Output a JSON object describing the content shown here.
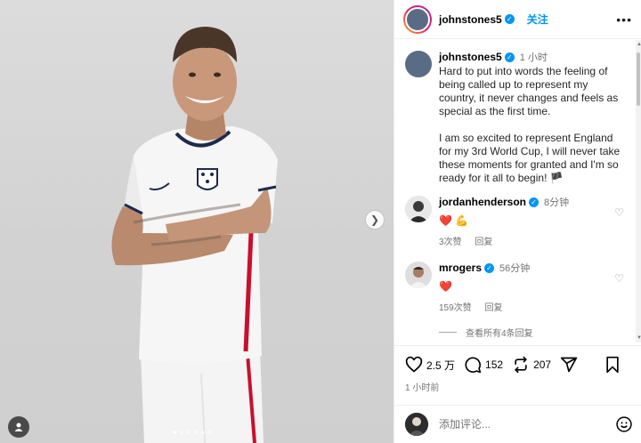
{
  "post": {
    "username": "johnstones5",
    "follow_label": "关注",
    "more_label": "•••",
    "time": "1 小时",
    "caption": "Hard to put into words the feeling of being called up to represent my country, it never changes and feels as special as the first time.\n\nI am so excited to represent England for my 3rd World Cup, I will never take these moments for granted and I'm so ready for it all to begin! 🏴",
    "posted_ago": "1 小时前"
  },
  "comments": [
    {
      "username": "jordanhenderson",
      "time": "8分钟",
      "text": "❤️ 💪",
      "likes": "3次赞",
      "reply_label": "回复"
    },
    {
      "username": "mrogers",
      "time": "56分钟",
      "text": "❤️",
      "likes": "159次赞",
      "reply_label": "回复",
      "view_all": "查看所有4条回复"
    }
  ],
  "actions": {
    "likes": "2.5 万",
    "comments": "152",
    "reposts": "207"
  },
  "composer": {
    "placeholder": "添加评论..."
  },
  "carousel": {
    "count": 6,
    "active": 0
  },
  "colors": {
    "accent": "#0095f6",
    "heart": "#ed4956",
    "kit_red": "#c8102e",
    "kit_navy": "#1d2a4d"
  }
}
